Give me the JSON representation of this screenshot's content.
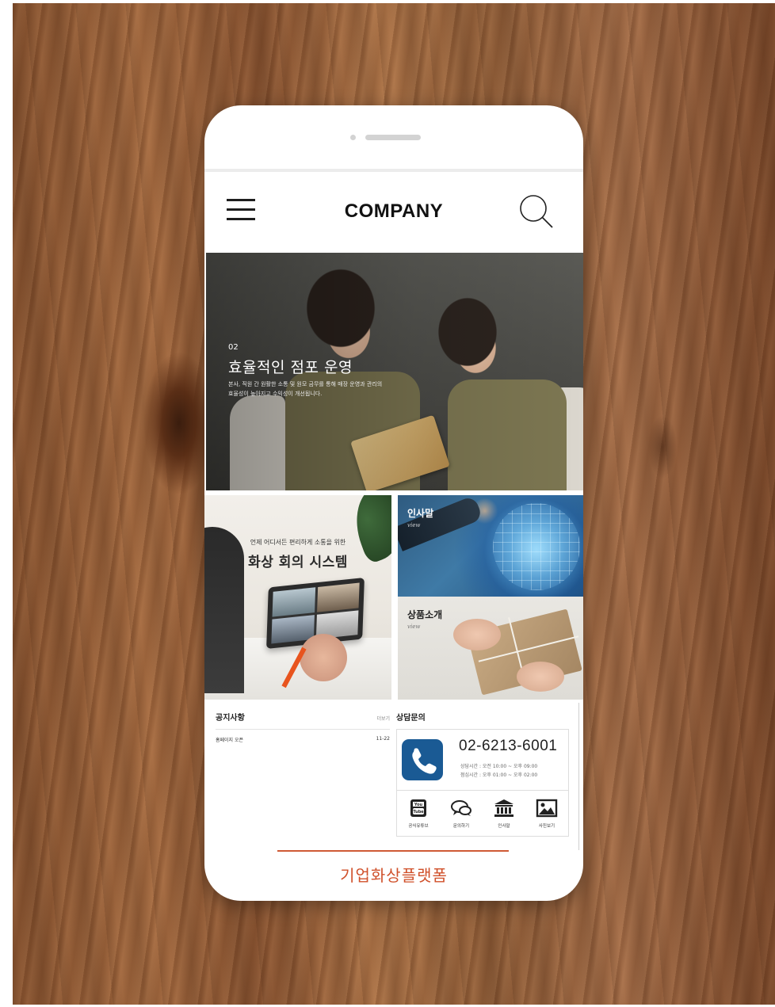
{
  "header": {
    "logo": "COMPANY"
  },
  "hero": {
    "number": "02",
    "title": "효율적인 점포 운영",
    "description": "본사, 직원 간 원활한 소통 및 원모 금무를 통해 매장 운영과 관리의 효율성이 높아지고 수익성이 개선됩니다."
  },
  "tiles": {
    "video": {
      "subtitle": "언제 어디서든 편리하게 소통을 위한",
      "title": "화상 회의 시스템"
    },
    "greeting": {
      "label": "인사말",
      "view": "view"
    },
    "product": {
      "label": "상품소개",
      "view": "view"
    }
  },
  "notice": {
    "title": "공지사항",
    "more": "더보기",
    "items": [
      {
        "title": "홈페이지 오픈",
        "date": "11-22"
      }
    ]
  },
  "consult": {
    "title": "상담문의",
    "phone": "02-6213-6001",
    "hours": [
      "상담시간 : 오전 10:00 ~ 오후 09:00",
      "점심시간 : 오후 01:00 ~ 오후 02:00"
    ],
    "links": [
      {
        "label": "공식유튜브",
        "icon": "youtube-icon"
      },
      {
        "label": "문의하기",
        "icon": "chat-icon"
      },
      {
        "label": "인사말",
        "icon": "bank-icon"
      },
      {
        "label": "사진보기",
        "icon": "picture-icon"
      }
    ]
  },
  "footer": {
    "text": "기업화상플랫폼",
    "accent_color": "#d0502a"
  }
}
